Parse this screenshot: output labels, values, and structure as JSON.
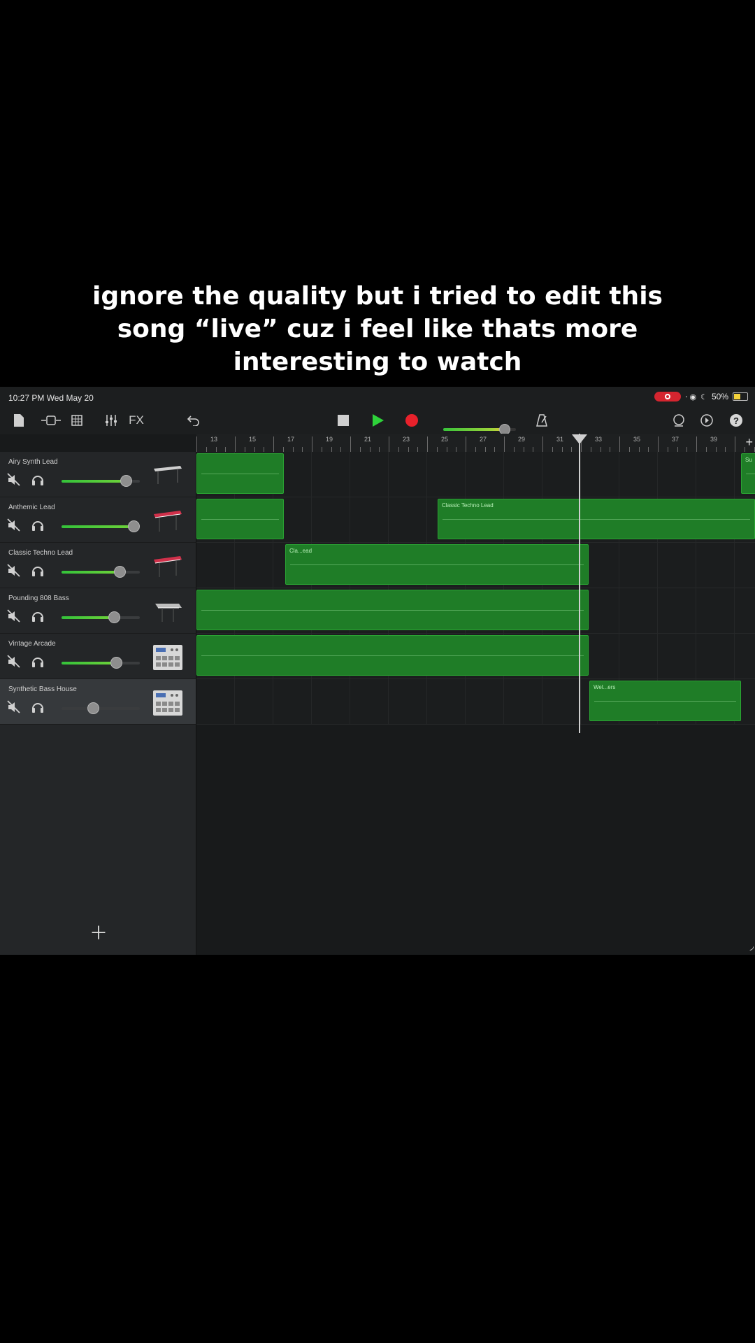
{
  "caption": {
    "lines": [
      "ignore the quality but i tried to edit this",
      "song “live” cuz i feel like thats more",
      "interesting to watch"
    ]
  },
  "statusbar": {
    "time": "10:27 PM  Wed May 20",
    "battery": "50%"
  },
  "toolbar": {
    "fx_label": "FX",
    "master_volume": 0.85
  },
  "ruler": {
    "bars": [
      "13",
      "15",
      "17",
      "19",
      "21",
      "23",
      "25",
      "27",
      "29",
      "31",
      "33",
      "35",
      "37",
      "39"
    ]
  },
  "tracks": [
    {
      "name": "Airy Synth Lead",
      "volume": 0.82,
      "selected": false,
      "instrument": "synth-keyboard-icon",
      "regions": [
        {
          "label": ""
        },
        {
          "label": "Su"
        }
      ]
    },
    {
      "name": "Anthemic Lead",
      "volume": 0.92,
      "selected": false,
      "instrument": "red-keyboard-icon",
      "regions": [
        {
          "label": ""
        },
        {
          "label": "Classic Techno Lead"
        }
      ]
    },
    {
      "name": "Classic Techno Lead",
      "volume": 0.74,
      "selected": false,
      "instrument": "red-keyboard-icon",
      "regions": [
        {
          "label": "Cla...ead"
        }
      ]
    },
    {
      "name": "Pounding 808 Bass",
      "volume": 0.67,
      "selected": false,
      "instrument": "grey-synth-icon",
      "regions": [
        {
          "label": ""
        }
      ]
    },
    {
      "name": "Vintage Arcade",
      "volume": 0.7,
      "selected": false,
      "instrument": "drum-machine-icon",
      "regions": [
        {
          "label": ""
        }
      ]
    },
    {
      "name": "Synthetic Bass House",
      "volume": 0.4,
      "selected": true,
      "instrument": "drum-machine-icon",
      "regions": [
        {
          "label": "Wel...ers"
        }
      ]
    }
  ],
  "colors": {
    "region_green": "#1f7d27",
    "play_green": "#2ed23a",
    "record_red": "#e8212b"
  }
}
